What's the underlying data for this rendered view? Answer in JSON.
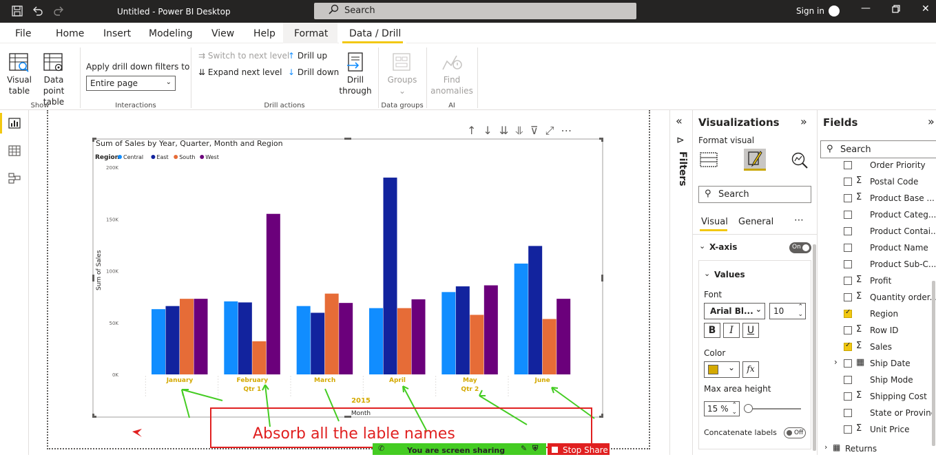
{
  "app": {
    "title": "Untitled - Power BI Desktop",
    "search_placeholder": "Search",
    "sign_in": "Sign in"
  },
  "menu": {
    "tabs": [
      {
        "label": "File"
      },
      {
        "label": "Home"
      },
      {
        "label": "Insert"
      },
      {
        "label": "Modeling"
      },
      {
        "label": "View"
      },
      {
        "label": "Help"
      },
      {
        "label": "Format",
        "contextual": true
      },
      {
        "label": "Data / Drill",
        "contextual": true,
        "active": true
      }
    ]
  },
  "ribbon": {
    "visual_table": "Visual table",
    "data_point_table": "Data point table",
    "group_show": "Show",
    "apply_drill_label": "Apply drill down filters to",
    "apply_drill_value": "Entire page",
    "group_interactions": "Interactions",
    "switch_next_level": "Switch to next level",
    "expand_next_level": "Expand next level",
    "drill_up": "Drill up",
    "drill_down": "Drill down",
    "drill_through": "Drill through",
    "group_drill_actions": "Drill actions",
    "groups": "Groups",
    "group_data_groups": "Data groups",
    "find_anomalies": "Find anomalies",
    "group_ai": "AI"
  },
  "chart_data": {
    "type": "bar",
    "title": "Sum of Sales by Year, Quarter, Month and Region",
    "legend_title": "Region",
    "legend_position": "top-left",
    "categories": [
      "January",
      "February",
      "March",
      "April",
      "May",
      "June"
    ],
    "quarter_labels": [
      {
        "label": "Qtr 1",
        "under": "February"
      },
      {
        "label": "Qtr 2",
        "under": "May"
      }
    ],
    "year_label": "2015",
    "xlabel": "Month",
    "ylabel": "Sum of Sales",
    "ylim": [
      0,
      200000
    ],
    "yticks": [
      "0K",
      "50K",
      "100K",
      "150K",
      "200K"
    ],
    "grid": true,
    "series": [
      {
        "name": "Central",
        "color": "#118dff",
        "values": [
          63000,
          70500,
          66000,
          64000,
          79500,
          107000
        ]
      },
      {
        "name": "East",
        "color": "#12239e",
        "values": [
          66000,
          69500,
          59500,
          190000,
          85000,
          124000
        ]
      },
      {
        "name": "South",
        "color": "#e66c37",
        "values": [
          73000,
          32000,
          78000,
          64000,
          57500,
          53500
        ]
      },
      {
        "name": "West",
        "color": "#6b007b",
        "values": [
          73000,
          155000,
          69000,
          72500,
          86000,
          73000
        ]
      }
    ]
  },
  "annotation": {
    "text": "Absorb all the  lable names",
    "color": "#e02020"
  },
  "filters_label": "Filters",
  "visualizations": {
    "title": "Visualizations",
    "format_visual": "Format visual",
    "search_placeholder": "Search",
    "tab_visual": "Visual",
    "tab_general": "General",
    "xaxis_label": "X-axis",
    "xaxis_toggle": "On",
    "values_label": "Values",
    "font_label": "Font",
    "font_value": "Arial Bl...",
    "font_size": "10",
    "bold": "B",
    "italic": "I",
    "underline": "U",
    "color_label": "Color",
    "color_value": "#d4a900",
    "fx": "fx",
    "max_area_label": "Max area height",
    "max_area_value": "15",
    "max_area_unit": "%",
    "concat_label": "Concatenate labels",
    "concat_toggle": "Off"
  },
  "fields": {
    "title": "Fields",
    "search_placeholder": "Search",
    "items": [
      {
        "name": "Order Priority",
        "sigma": false,
        "checked": false
      },
      {
        "name": "Postal Code",
        "sigma": true,
        "checked": false
      },
      {
        "name": "Product Base ...",
        "sigma": true,
        "checked": false
      },
      {
        "name": "Product Categ...",
        "sigma": false,
        "checked": false
      },
      {
        "name": "Product Contai...",
        "sigma": false,
        "checked": false
      },
      {
        "name": "Product Name",
        "sigma": false,
        "checked": false
      },
      {
        "name": "Product Sub-C...",
        "sigma": false,
        "checked": false
      },
      {
        "name": "Profit",
        "sigma": true,
        "checked": false
      },
      {
        "name": "Quantity order...",
        "sigma": true,
        "checked": false
      },
      {
        "name": "Region",
        "sigma": false,
        "checked": true
      },
      {
        "name": "Row ID",
        "sigma": true,
        "checked": false
      },
      {
        "name": "Sales",
        "sigma": true,
        "checked": true
      },
      {
        "name": "Ship Date",
        "sigma": false,
        "checked": false,
        "hierarchy": true
      },
      {
        "name": "Ship Mode",
        "sigma": false,
        "checked": false
      },
      {
        "name": "Shipping Cost",
        "sigma": true,
        "checked": false
      },
      {
        "name": "State or Province",
        "sigma": false,
        "checked": false
      },
      {
        "name": "Unit Price",
        "sigma": true,
        "checked": false
      }
    ],
    "table_name": "Returns"
  },
  "share_bar": {
    "text": "You are screen sharing",
    "stop": "Stop Share"
  }
}
